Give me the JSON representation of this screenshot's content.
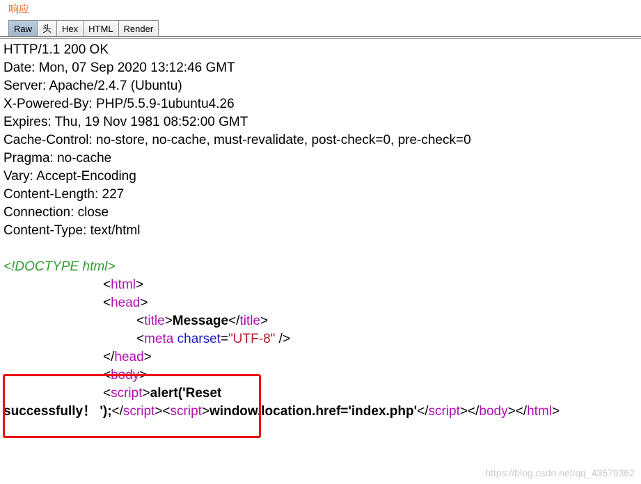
{
  "panel": {
    "title": "响应"
  },
  "tabs": [
    {
      "label": "Raw",
      "active": true
    },
    {
      "label": "头",
      "active": false
    },
    {
      "label": "Hex",
      "active": false
    },
    {
      "label": "HTML",
      "active": false
    },
    {
      "label": "Render",
      "active": false
    }
  ],
  "headers": [
    "HTTP/1.1 200 OK",
    "Date: Mon, 07 Sep 2020 13:12:46 GMT",
    "Server: Apache/2.4.7 (Ubuntu)",
    "X-Powered-By: PHP/5.5.9-1ubuntu4.26",
    "Expires: Thu, 19 Nov 1981 08:52:00 GMT",
    "Cache-Control: no-store, no-cache, must-revalidate, post-check=0, pre-check=0",
    "Pragma: no-cache",
    "Vary: Accept-Encoding",
    "Content-Length: 227",
    "Connection: close",
    "Content-Type: text/html"
  ],
  "body": {
    "doctype": "<!DOCTYPE html>",
    "html_tag": "html",
    "head_tag": "head",
    "title_tag": "title",
    "title_text": "Message",
    "meta_tag": "meta",
    "meta_attr": "charset",
    "meta_value": "\"UTF-8\"",
    "body_tag": "body",
    "script_tag": "script",
    "alert_line1": "alert('Reset",
    "alert_line2": "successfully！ ');",
    "redirect_script": "window.location.href='index.php'"
  },
  "watermark": "https://blog.csdn.net/qq_43579362",
  "highlight_color": "#ee1111"
}
